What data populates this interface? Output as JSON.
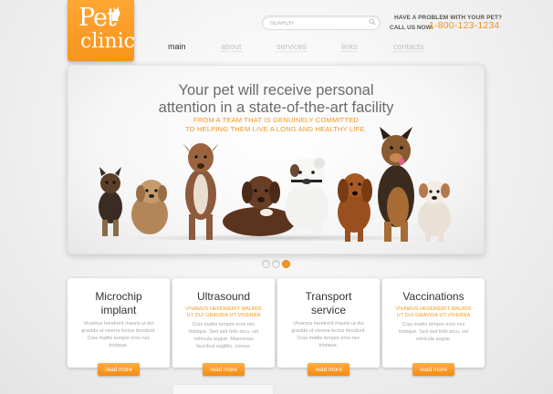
{
  "logo": {
    "line1": "Pet",
    "line2": "clinic"
  },
  "search": {
    "placeholder": "SEARCH"
  },
  "contact": {
    "question": "HAVE A PROBLEM WITH YOUR PET?",
    "call_label": "CALL US NOW:",
    "phone": "1-800-123-1234"
  },
  "nav": {
    "items": [
      {
        "label": "main",
        "active": true
      },
      {
        "label": "about",
        "active": false
      },
      {
        "label": "services",
        "active": false
      },
      {
        "label": "links",
        "active": false
      },
      {
        "label": "contacts",
        "active": false
      }
    ]
  },
  "banner": {
    "title_line1": "Your pet will receive personal",
    "title_line2": "attention in a state-of-the-art facility",
    "subtitle_line1": "FROM A TEAM THAT IS GENUINELY COMMITTED",
    "subtitle_line2": "TO HELPING THEM LIVE A LONG AND HEALTHY LIFE."
  },
  "slider": {
    "count": 3,
    "active_index": 2
  },
  "colors": {
    "accent": "#f7941d",
    "text_dark": "#333333",
    "text_muted": "#a6a6a6"
  },
  "cards": [
    {
      "title1": "Microchip",
      "title2": "implant",
      "orange1": "",
      "orange2": "",
      "body": [
        "Vivamus hendrerit mauris ut dui",
        "gravida ut viverra lectus tincidunt.",
        "Cras mattis tempor eros nec",
        "tristique."
      ],
      "button": "read more"
    },
    {
      "title1": "Ultrasound",
      "title2": "",
      "orange1": "VIVAMUS HENDRERIT MAURIS",
      "orange2": "UT DUI GRAVIDA UT VIVERRA",
      "body": [
        "Cras mattis tempor eros nec",
        "tristique. Sed sed felis arcu, vel",
        "vehicula augue. Maecenas",
        "faucibus sagittis. cursus."
      ],
      "button": "read more"
    },
    {
      "title1": "Transport",
      "title2": "service",
      "orange1": "",
      "orange2": "",
      "body": [
        "Vivamus hendrerit mauris ut dui",
        "gravida ut viverra lectus tincidunt.",
        "Cras mattis tempor eros nec",
        "tristique."
      ],
      "button": "read more"
    },
    {
      "title1": "Vaccinations",
      "title2": "",
      "orange1": "VIVAMUS HENDRERIT MAURIS",
      "orange2": "UT DUI GRAVIDA UT VIVERRA",
      "body": [
        "Cras mattis tempor eros nec",
        "tristique. Sed sed felis arcu, vel",
        "vehicula augue."
      ],
      "button": "read more"
    }
  ]
}
